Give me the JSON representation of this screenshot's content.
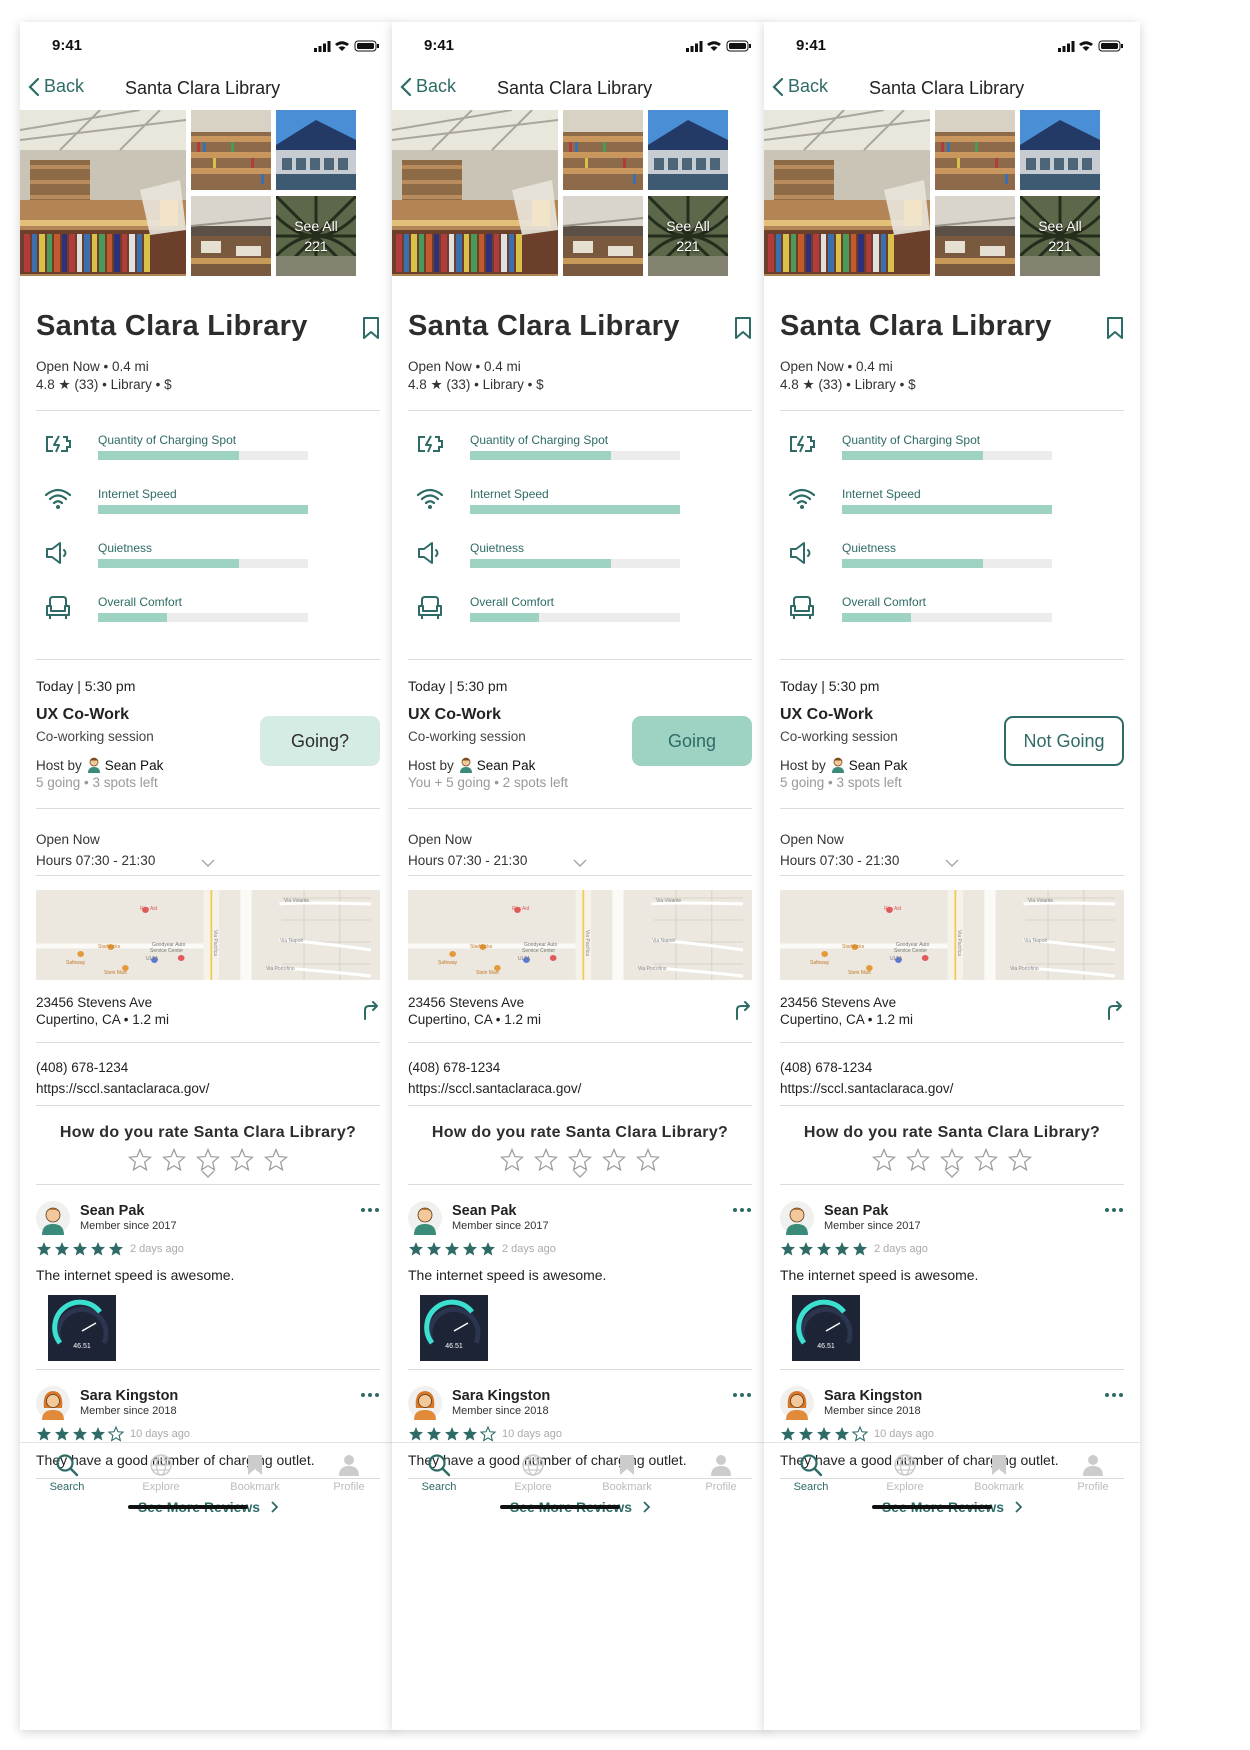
{
  "status": {
    "time": "9:41"
  },
  "nav": {
    "back_label": "Back",
    "title": "Santa Clara Library"
  },
  "photos": {
    "see_all_label": "See All",
    "count": "221"
  },
  "place": {
    "name": "Santa Clara Library",
    "meta_line1": "Open Now • 0.4 mi",
    "meta_line2": "4.8 ★ (33) • Library • $"
  },
  "ratings": [
    {
      "icon": "charging-icon",
      "label": "Quantity of Charging Spot",
      "value": 0.67
    },
    {
      "icon": "wifi-icon",
      "label": "Internet Speed",
      "value": 1.0
    },
    {
      "icon": "speaker-icon",
      "label": "Quietness",
      "value": 0.67
    },
    {
      "icon": "armchair-icon",
      "label": "Overall Comfort",
      "value": 0.33
    }
  ],
  "event": {
    "date": "Today | 5:30 pm",
    "name": "UX Co-Work",
    "subtitle": "Co-working session",
    "host_prefix": "Host by",
    "host_name": "Sean Pak"
  },
  "screens": [
    {
      "rsvp_label": "Going?",
      "going_text": "5 going • 3 spots left"
    },
    {
      "rsvp_label": "Going",
      "going_text": "You + 5 going • 2 spots left"
    },
    {
      "rsvp_label": "Not Going",
      "going_text": "5 going • 3 spots left"
    }
  ],
  "hours": {
    "status": "Open Now",
    "hours": "Hours 07:30 - 21:30"
  },
  "map": {
    "labels": [
      "Rite Aid",
      "Starbucks",
      "Goodyear Auto",
      "Service Center",
      "ULTA",
      "Safeway",
      "Stein Mart",
      "Via Volante",
      "Via Napoli",
      "Via Portofino",
      "Via Pacifica"
    ]
  },
  "address": {
    "line1": "23456 Stevens Ave",
    "line2": "Cupertino, CA  • 1.2 mi"
  },
  "contact": {
    "phone": "(408) 678-1234",
    "website": "https://sccl.santaclaraca.gov/"
  },
  "rate_prompt": "How do you rate Santa Clara Library?",
  "reviews": [
    {
      "name": "Sean Pak",
      "since": "Member since 2017",
      "stars": 5,
      "time": "2 days ago",
      "text": "The internet speed is awesome.",
      "speed_value": "46.51"
    },
    {
      "name": "Sara Kingston",
      "since": "Member since 2018",
      "stars": 4,
      "time": "10 days ago",
      "text": "They have a good number of charging outlet."
    }
  ],
  "see_more_label": "See More Reviews",
  "tabs": [
    {
      "label": "Search",
      "icon": "search-icon",
      "active": true
    },
    {
      "label": "Explore",
      "icon": "globe-icon",
      "active": false
    },
    {
      "label": "Bookmark",
      "icon": "bookmark-icon",
      "active": false
    },
    {
      "label": "Profile",
      "icon": "profile-icon",
      "active": false
    }
  ],
  "colors": {
    "accent": "#2e6b66",
    "bar_fill": "#9ed3c3",
    "bar_track": "#ececec"
  }
}
